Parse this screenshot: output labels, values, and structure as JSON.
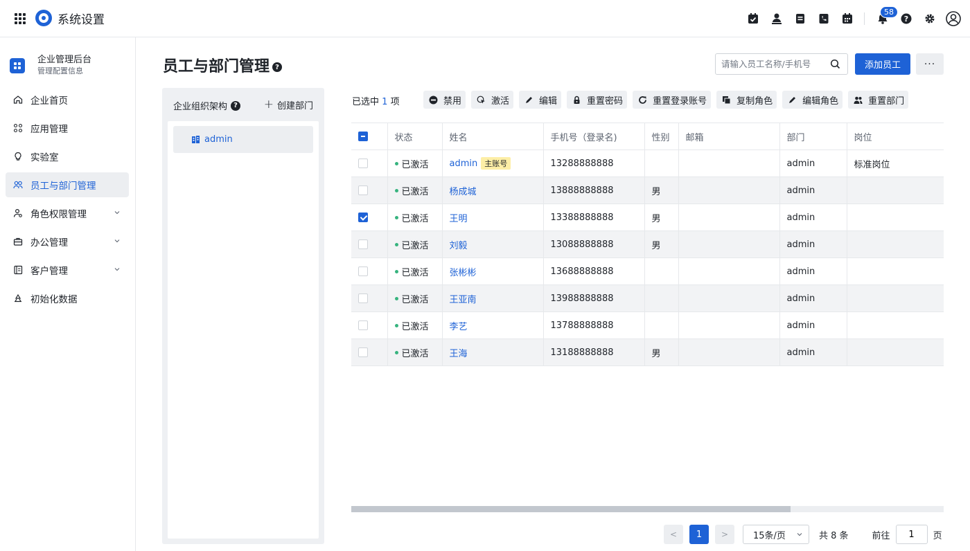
{
  "header": {
    "app_title": "系统设置",
    "notification_count": "58"
  },
  "sidebar": {
    "enterprise_name": "企业管理后台",
    "enterprise_sub": "管理配置信息",
    "items": [
      {
        "label": "企业首页",
        "icon": "home-icon"
      },
      {
        "label": "应用管理",
        "icon": "apps-icon"
      },
      {
        "label": "实验室",
        "icon": "lightbulb-icon"
      },
      {
        "label": "员工与部门管理",
        "icon": "users-icon",
        "active": true
      },
      {
        "label": "角色权限管理",
        "icon": "user-role-icon",
        "expandable": true
      },
      {
        "label": "办公管理",
        "icon": "briefcase-icon",
        "expandable": true
      },
      {
        "label": "客户管理",
        "icon": "contacts-icon",
        "expandable": true
      },
      {
        "label": "初始化数据",
        "icon": "recycle-icon"
      }
    ]
  },
  "main": {
    "title": "员工与部门管理",
    "search_placeholder": "请输入员工名称/手机号",
    "add_button": "添加员工",
    "more_button": "···"
  },
  "org": {
    "title": "企业组织架构",
    "create_label": "创建部门",
    "root_node": "admin"
  },
  "toolbar": {
    "selected_prefix": "已选中",
    "selected_count": "1",
    "selected_suffix": "项",
    "actions": [
      "禁用",
      "激活",
      "编辑",
      "重置密码",
      "重置登录账号",
      "复制角色",
      "编辑角色",
      "重置部门"
    ]
  },
  "table": {
    "columns": [
      "状态",
      "姓名",
      "手机号（登录名)",
      "性别",
      "邮箱",
      "部门",
      "岗位"
    ],
    "main_account_tag": "主账号",
    "rows": [
      {
        "status": "已激活",
        "name": "admin",
        "phone": "13288888888",
        "gender": "",
        "email": "",
        "dept": "admin",
        "post": "标准岗位",
        "checked": false,
        "main": true
      },
      {
        "status": "已激活",
        "name": "杨成城",
        "phone": "13888888888",
        "gender": "男",
        "email": "",
        "dept": "admin",
        "post": "",
        "checked": false
      },
      {
        "status": "已激活",
        "name": "王明",
        "phone": "13388888888",
        "gender": "男",
        "email": "",
        "dept": "admin",
        "post": "",
        "checked": true
      },
      {
        "status": "已激活",
        "name": "刘毅",
        "phone": "13088888888",
        "gender": "男",
        "email": "",
        "dept": "admin",
        "post": "",
        "checked": false
      },
      {
        "status": "已激活",
        "name": "张彬彬",
        "phone": "13688888888",
        "gender": "",
        "email": "",
        "dept": "admin",
        "post": "",
        "checked": false
      },
      {
        "status": "已激活",
        "name": "王亚南",
        "phone": "13988888888",
        "gender": "",
        "email": "",
        "dept": "admin",
        "post": "",
        "checked": false
      },
      {
        "status": "已激活",
        "name": "李艺",
        "phone": "13788888888",
        "gender": "",
        "email": "",
        "dept": "admin",
        "post": "",
        "checked": false
      },
      {
        "status": "已激活",
        "name": "王海",
        "phone": "13188888888",
        "gender": "男",
        "email": "",
        "dept": "admin",
        "post": "",
        "checked": false
      }
    ]
  },
  "pagination": {
    "current_page": "1",
    "page_size": "15条/页",
    "total": "共 8 条",
    "goto_label": "前往",
    "goto_value": "1",
    "page_unit": "页"
  }
}
